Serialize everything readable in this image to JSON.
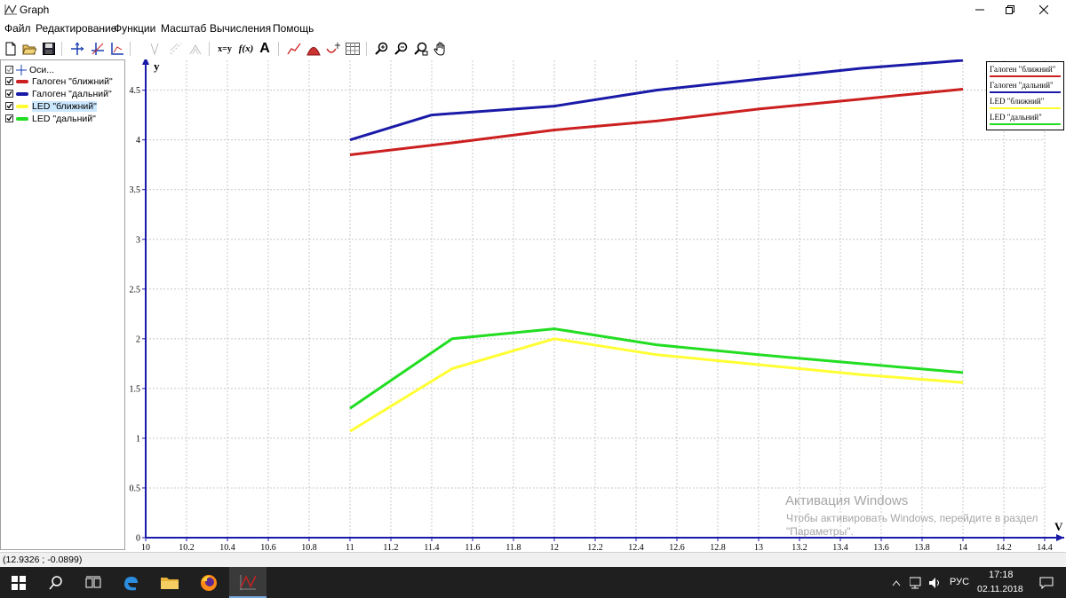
{
  "window": {
    "title": "Graph"
  },
  "menu": [
    "Файл",
    "Редактирование",
    "Функции",
    "Масштаб",
    "Вычисления",
    "Помощь"
  ],
  "toolbar": {
    "buttons": [
      "new-file-icon",
      "open-folder-icon",
      "save-icon",
      "axes-icon",
      "grid-icon",
      "axes-dialog-icon",
      "tangent-icon",
      "shading-icon",
      "series-icon",
      "xy-function-icon",
      "fx-function-icon",
      "text-label-icon",
      "point-series-icon",
      "area-icon",
      "evaluate-icon",
      "table-icon",
      "zoom-in-icon",
      "zoom-out-icon",
      "zoom-window-icon",
      "pan-hand-icon"
    ],
    "xy_label": "x=y",
    "fx_label": "f(x)",
    "text_label": "A"
  },
  "panel": {
    "items": [
      {
        "label": "Оси...",
        "icon": "axes-icon",
        "selected": false
      },
      {
        "label": "Галоген \"ближний\"",
        "color": "#cc1f1f",
        "selected": false
      },
      {
        "label": "Галоген \"дальний\"",
        "color": "#1a1aa8",
        "selected": false
      },
      {
        "label": "LED \"ближний\"",
        "color": "#ffff33",
        "selected": true
      },
      {
        "label": "LED \"дальний\"",
        "color": "#22dd22",
        "selected": false
      }
    ]
  },
  "chart_data": {
    "type": "line",
    "xlabel": "V",
    "ylabel": "y",
    "xlim": [
      10,
      14.4
    ],
    "ylim": [
      0,
      4.8
    ],
    "xticks": [
      "10",
      "10.2",
      "10.4",
      "10.6",
      "10.8",
      "11",
      "11.2",
      "11.4",
      "11.6",
      "11.8",
      "12",
      "12.2",
      "12.4",
      "12.6",
      "12.8",
      "13",
      "13.2",
      "13.4",
      "13.6",
      "13.8",
      "14",
      "14.2",
      "14.4"
    ],
    "yticks": [
      "0",
      "0.5",
      "1",
      "1.5",
      "2",
      "2.5",
      "3",
      "3.5",
      "4",
      "4.5"
    ],
    "grid": true,
    "legend_position": "top-right",
    "series": [
      {
        "name": "Галоген \"ближний\"",
        "color": "#cc1f1f",
        "x": [
          11,
          11.5,
          12,
          12.5,
          13,
          13.5,
          14
        ],
        "y": [
          3.85,
          3.97,
          4.1,
          4.19,
          4.31,
          4.41,
          4.51
        ]
      },
      {
        "name": "Галоген \"дальний\"",
        "color": "#1a1aa8",
        "x": [
          11,
          11.4,
          12,
          12.5,
          13,
          13.5,
          14
        ],
        "y": [
          4.0,
          4.25,
          4.34,
          4.5,
          4.61,
          4.72,
          4.8
        ]
      },
      {
        "name": "LED \"ближний\"",
        "color": "#ffff33",
        "x": [
          11,
          11.5,
          12,
          12.5,
          13,
          13.5,
          14
        ],
        "y": [
          1.07,
          1.7,
          2.0,
          1.84,
          1.74,
          1.64,
          1.56
        ]
      },
      {
        "name": "LED \"дальний\"",
        "color": "#22dd22",
        "x": [
          11,
          11.5,
          12,
          12.5,
          13,
          13.5,
          14
        ],
        "y": [
          1.3,
          2.0,
          2.1,
          1.94,
          1.84,
          1.75,
          1.66
        ]
      }
    ]
  },
  "watermark": {
    "title": "Активация Windows",
    "subtitle": "Чтобы активировать Windows, перейдите в раздел \"Параметры\"."
  },
  "status": {
    "coords": "(12.9326 ; -0.0899)"
  },
  "taskbar": {
    "apps": [
      "windows-start-icon",
      "search-icon",
      "task-view-icon",
      "edge-icon",
      "file-explorer-icon",
      "firefox-icon",
      "graph-app-icon"
    ],
    "lang": "РУС",
    "time": "17:18",
    "date": "02.11.2018"
  }
}
